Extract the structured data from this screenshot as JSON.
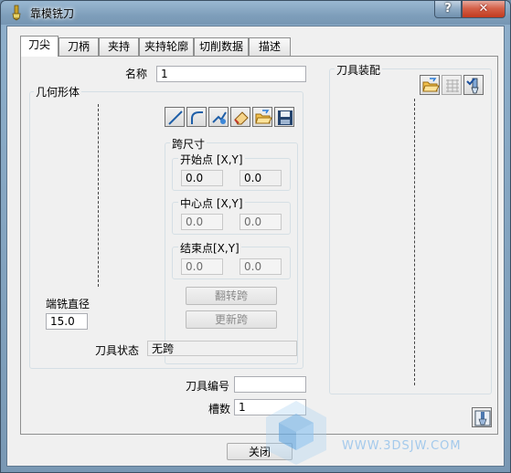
{
  "window": {
    "title": "靠模铣刀",
    "help_label": "?",
    "close_label": "✕"
  },
  "tabs": [
    {
      "label": "刀尖"
    },
    {
      "label": "刀柄"
    },
    {
      "label": "夹持"
    },
    {
      "label": "夹持轮廓"
    },
    {
      "label": "切削数据"
    },
    {
      "label": "描述"
    }
  ],
  "name_field": {
    "label": "名称",
    "value": "1"
  },
  "geometry": {
    "title": "几何形体",
    "toolbar_icons": [
      "line-icon",
      "arc-icon",
      "tool-shape-icon",
      "eraser-icon",
      "open-folder-icon",
      "save-disk-icon"
    ],
    "span": {
      "title": "跨尺寸",
      "start": {
        "title": "开始点 [X,Y]",
        "x": "0.0",
        "y": "0.0"
      },
      "center": {
        "title": "中心点 [X,Y]",
        "x": "0.0",
        "y": "0.0"
      },
      "end": {
        "title": "结束点[X,Y]",
        "x": "0.0",
        "y": "0.0"
      },
      "flip_label": "翻转跨",
      "update_label": "更新跨"
    },
    "diameter_label": "端铣直径",
    "diameter_value": "15.0",
    "status_label": "刀具状态",
    "status_value": "无跨"
  },
  "assembly": {
    "title": "刀具装配",
    "icons": [
      "open-folder-icon",
      "grid-icon",
      "tool-check-icon"
    ]
  },
  "tool_number": {
    "label": "刀具编号",
    "value": ""
  },
  "flutes": {
    "label": "槽数",
    "value": "1"
  },
  "close_button": {
    "label": "关闭"
  },
  "corner_icon": "tool-preview-icon",
  "watermark": {
    "text": "WWW.3DSJW.COM"
  }
}
